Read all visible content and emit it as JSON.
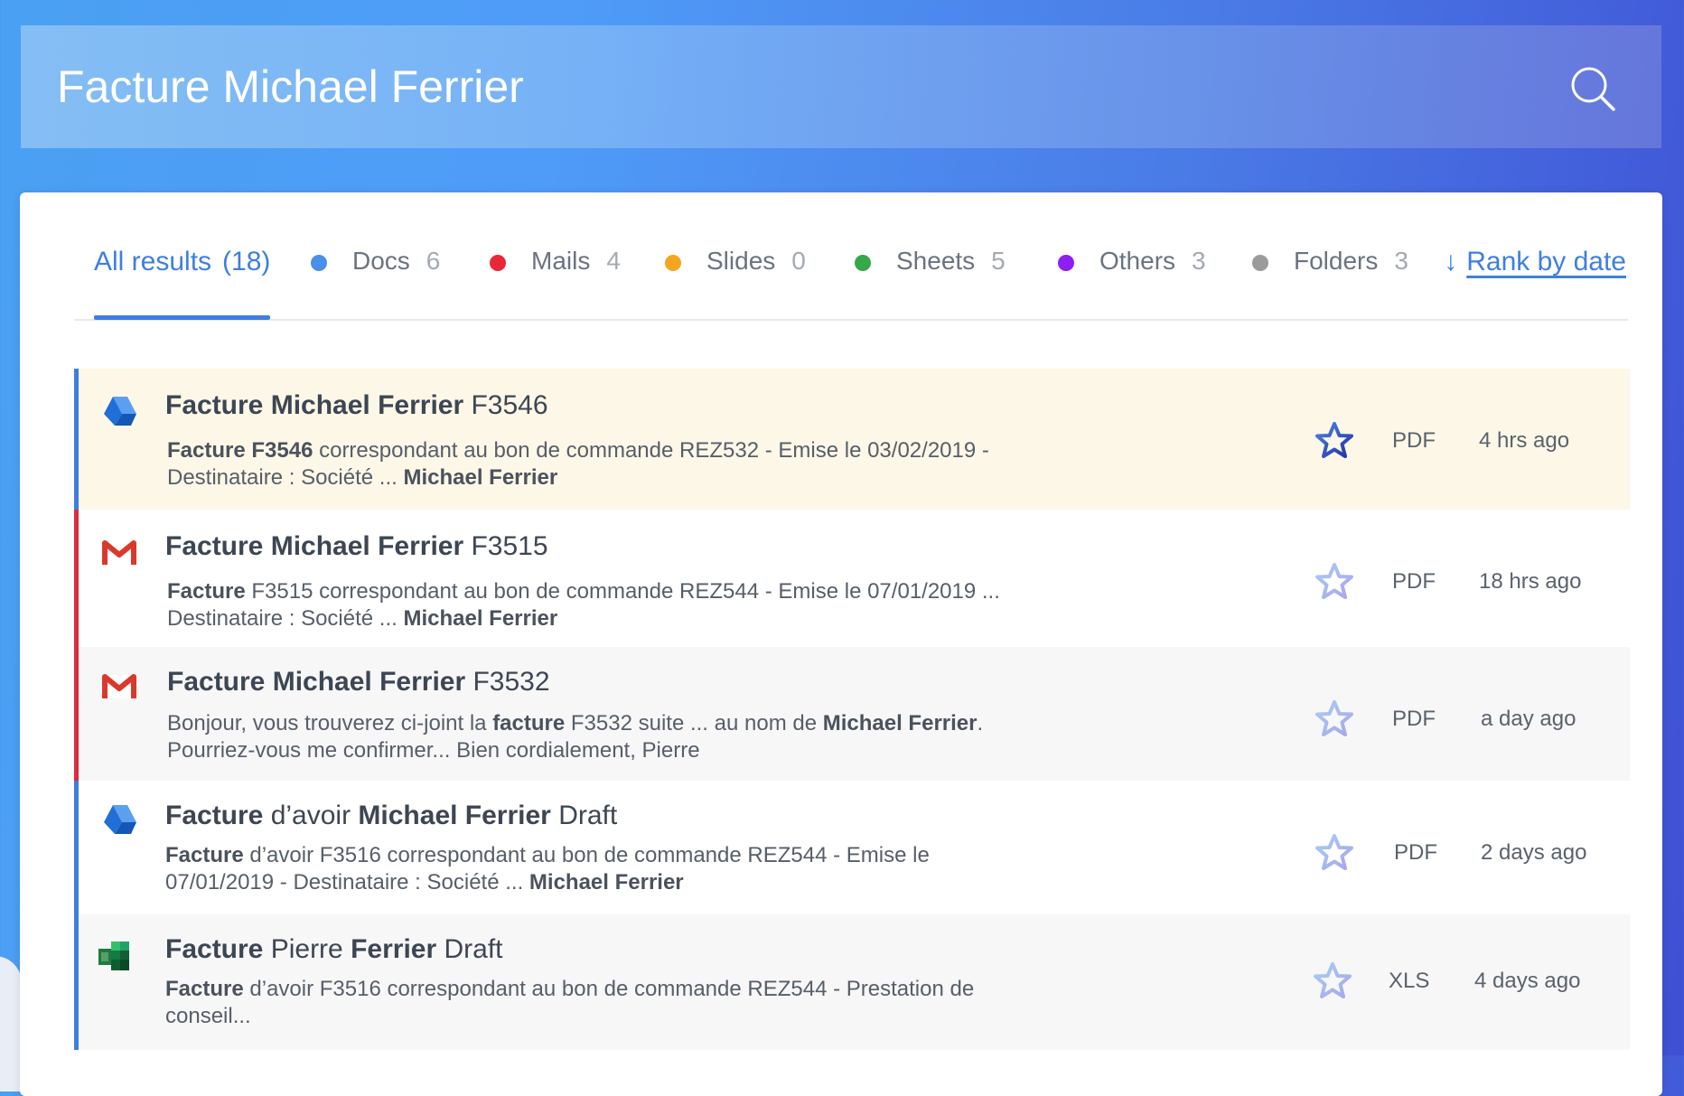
{
  "search": {
    "query": "Facture Michael Ferrier"
  },
  "tabs": {
    "all": {
      "label": "All results",
      "count": "(18)"
    },
    "items": [
      {
        "label": "Docs",
        "count": "6",
        "color": "#4a8fe8"
      },
      {
        "label": "Mails",
        "count": "4",
        "color": "#e8283a"
      },
      {
        "label": "Slides",
        "count": "0",
        "color": "#f4a623"
      },
      {
        "label": "Sheets",
        "count": "5",
        "color": "#36a84a"
      },
      {
        "label": "Others",
        "count": "3",
        "color": "#8e1ff0"
      },
      {
        "label": "Folders",
        "count": "3",
        "color": "#9b9b9b"
      }
    ],
    "rank": {
      "arrow": "↓",
      "label": "Rank by date"
    }
  },
  "results": [
    {
      "icon": "drive-icon",
      "title_bold": "Facture Michael Ferrier",
      "title_rest": "F3546",
      "snippet_b1": "Facture F3546",
      "snippet_t1": " correspondant au bon de commande REZ532 - Emise le 03/02/2019 - Destinataire : Société ... ",
      "snippet_b2": "Michael Ferrier",
      "snippet_t2": "",
      "starred": true,
      "type": "PDF",
      "time": "4 hrs ago"
    },
    {
      "icon": "gmail-icon",
      "title_bold": "Facture Michael Ferrier",
      "title_rest": "F3515",
      "snippet_b1": "Facture",
      "snippet_t1": " F3515 correspondant au bon de commande REZ544 - Emise le 07/01/2019 ... Destinataire : Société ... ",
      "snippet_b2": "Michael Ferrier",
      "snippet_t2": "",
      "starred": false,
      "type": "PDF",
      "time": "18 hrs ago"
    },
    {
      "icon": "gmail-icon",
      "title_bold": "Facture Michael Ferrier",
      "title_rest": "F3532",
      "snippet_pre": "Bonjour, vous trouverez ci-joint la ",
      "snippet_b1": "facture",
      "snippet_t1": " F3532 suite ... au nom de ",
      "snippet_b2": "Michael Ferrier",
      "snippet_t2": ". Pourriez-vous me confirmer... Bien cordialement, Pierre",
      "starred": false,
      "type": "PDF",
      "time": "a day ago"
    },
    {
      "icon": "drive-icon",
      "title_bold": "Facture",
      "title_mid": " d’avoir ",
      "title_bold2": "Michael Ferrier",
      "title_rest": "Draft",
      "snippet_b1": "Facture",
      "snippet_t1": " d’avoir F3516 correspondant au bon de commande REZ544 - Emise le 07/01/2019 - Destinataire : Société ... ",
      "snippet_b2": "Michael Ferrier",
      "snippet_t2": "",
      "starred": false,
      "type": "PDF",
      "time": "2 days ago"
    },
    {
      "icon": "sheets-icon",
      "title_bold": "Facture",
      "title_mid": " Pierre ",
      "title_bold2": "Ferrier",
      "title_rest": "Draft",
      "snippet_b1": "Facture",
      "snippet_t1": " d’avoir F3516 correspondant au bon de commande REZ544 - Prestation de conseil...",
      "snippet_b2": "",
      "snippet_t2": "",
      "starred": false,
      "type": "XLS",
      "time": "4 days ago"
    }
  ]
}
